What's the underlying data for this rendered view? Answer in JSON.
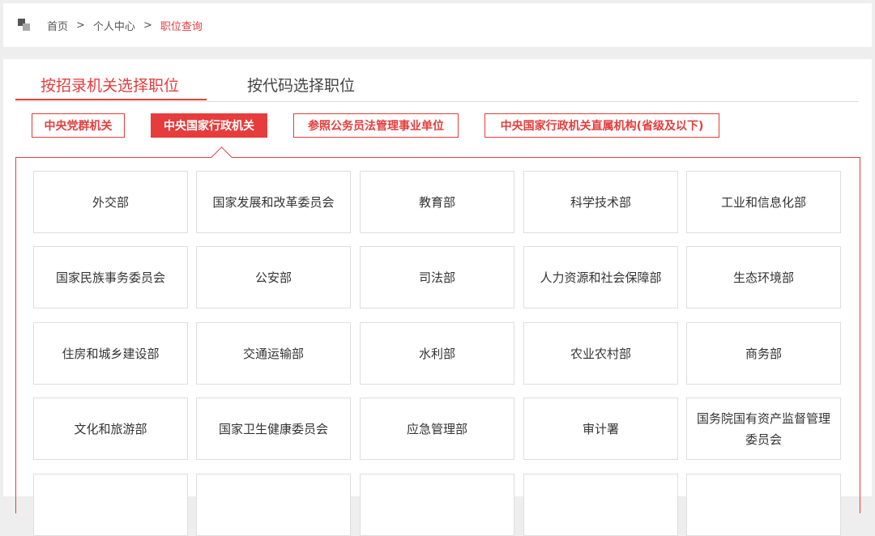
{
  "breadcrumb": {
    "items": [
      "首页",
      "个人中心",
      "职位查询"
    ],
    "separator": ">"
  },
  "tabs": [
    "按招录机关选择职位",
    "按代码选择职位"
  ],
  "categories": [
    "中央党群机关",
    "中央国家行政机关",
    "参照公务员法管理事业单位",
    "中央国家行政机关直属机构(省级及以下)"
  ],
  "departments": [
    "外交部",
    "国家发展和改革委员会",
    "教育部",
    "科学技术部",
    "工业和信息化部",
    "国家民族事务委员会",
    "公安部",
    "司法部",
    "人力资源和社会保障部",
    "生态环境部",
    "住房和城乡建设部",
    "交通运输部",
    "水利部",
    "农业农村部",
    "商务部",
    "文化和旅游部",
    "国家卫生健康委员会",
    "应急管理部",
    "审计署",
    "国务院国有资产监督管理委员会",
    "",
    "",
    "",
    "",
    ""
  ],
  "colors": {
    "accent": "#e63c3c"
  }
}
